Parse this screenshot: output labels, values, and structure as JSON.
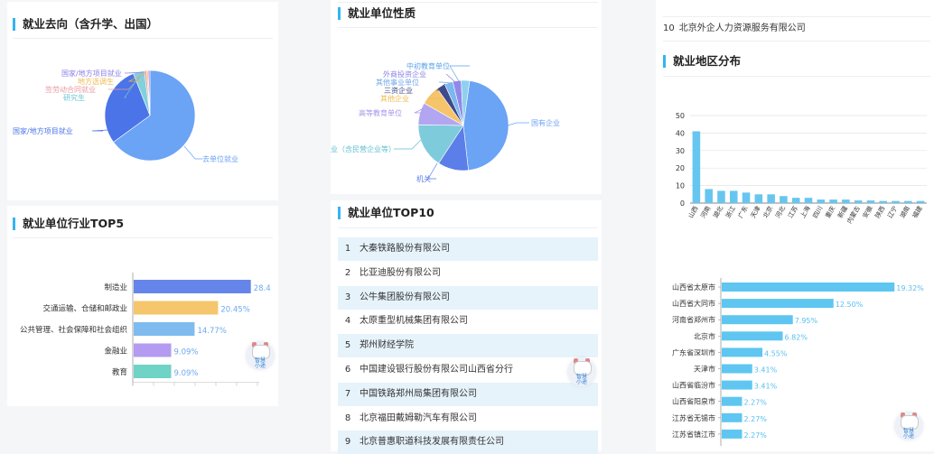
{
  "panels": {
    "destination": {
      "title": "就业去向（含升学、出国）",
      "slice_labels": [
        "国家/地方项目就业",
        "地方选调生",
        "签劳动合同就业",
        "研究生",
        "国家/地方项目就业",
        "去单位就业"
      ],
      "chart_data": {
        "type": "pie",
        "labels": [
          "去单位就业",
          "国家/地方项目就业",
          "研究生",
          "签劳动合同就业",
          "地方选调生",
          "国家/地方项目就业"
        ],
        "values": [
          65,
          29,
          4,
          0.8,
          0.6,
          0.6
        ],
        "colors": [
          "#6ba3f5",
          "#4a74e8",
          "#7fd1dd",
          "#e8a0a6",
          "#f5c66b",
          "#9a8df0"
        ]
      }
    },
    "unit_nature": {
      "title": "就业单位性质",
      "slice_labels": [
        "中初教育单位",
        "外商投资企业",
        "其他事业单位",
        "三资企业",
        "其他企业",
        "高等教育单位",
        "业（含民营企业等）",
        "机关",
        "国有企业"
      ],
      "chart_data": {
        "type": "pie",
        "labels": [
          "国有企业",
          "机关",
          "其他企业（含民营企业等）",
          "高等教育单位",
          "其他企业",
          "三资企业",
          "其他事业单位",
          "外商投资企业",
          "中初教育单位"
        ],
        "values": [
          46,
          11,
          16,
          8,
          7,
          3,
          3,
          3,
          3
        ],
        "colors": [
          "#6ba3f5",
          "#5c7ee8",
          "#7ecbdb",
          "#b2a6f0",
          "#f6c46b",
          "#3e4a8a",
          "#7bb8f0",
          "#9188e8",
          "#8fd0ef"
        ]
      }
    },
    "region": {
      "title": "就业地区分布",
      "chart_data": {
        "type": "bar",
        "categories": [
          "山西",
          "河南",
          "湖北",
          "浙江",
          "广东",
          "天津",
          "北京",
          "河北",
          "江苏",
          "上海",
          "四川",
          "重庆",
          "新疆",
          "内蒙古",
          "安徽",
          "陕西",
          "辽宁",
          "湖南",
          "福建"
        ],
        "values": [
          41,
          8,
          7,
          7,
          6,
          5,
          5,
          4,
          3,
          3,
          2,
          2,
          2,
          1.5,
          1.5,
          1.2,
          1.2,
          1.2,
          1.2
        ],
        "ylim": [
          0,
          50
        ],
        "yticks": [
          "0",
          "10",
          "20",
          "30",
          "40",
          "50"
        ],
        "color": "#66c6f0"
      }
    },
    "industry": {
      "title": "就业单位行业TOP5",
      "chart_data": {
        "type": "bar",
        "orientation": "horizontal",
        "categories": [
          "制造业",
          "交通运输、仓储和邮政业",
          "公共管理、社会保障和社会组织",
          "金融业",
          "教育"
        ],
        "values": [
          28.4,
          20.45,
          14.77,
          9.09,
          9.09
        ],
        "value_labels": [
          "28.4",
          "20.45%",
          "14.77%",
          "9.09%",
          "9.09%"
        ],
        "colors": [
          "#6685ea",
          "#f5c66b",
          "#7fbbee",
          "#b49af0",
          "#6fd3c6"
        ],
        "xlim": [
          0,
          30
        ]
      }
    },
    "top10": {
      "title": "就业单位TOP10",
      "items": [
        {
          "rank": "1",
          "name": "大秦铁路股份有限公司"
        },
        {
          "rank": "2",
          "name": "比亚迪股份有限公司"
        },
        {
          "rank": "3",
          "name": "公牛集团股份有限公司"
        },
        {
          "rank": "4",
          "name": "太原重型机械集团有限公司"
        },
        {
          "rank": "5",
          "name": "郑州财经学院"
        },
        {
          "rank": "6",
          "name": "中国建设银行股份有限公司山西省分行"
        },
        {
          "rank": "7",
          "name": "中国铁路郑州局集团有限公司"
        },
        {
          "rank": "8",
          "name": "北京福田戴姆勒汽车有限公司"
        },
        {
          "rank": "9",
          "name": "北京普惠职道科技发展有限责任公司"
        },
        {
          "rank": "10",
          "name": "北京外企人力资源服务有限公司"
        }
      ]
    },
    "city": {
      "chart_data": {
        "type": "bar",
        "orientation": "horizontal",
        "categories": [
          "山西省太原市",
          "山西省大同市",
          "河南省郑州市",
          "北京市",
          "广东省深圳市",
          "天津市",
          "山西省临汾市",
          "山西省阳泉市",
          "江苏省无锡市",
          "江苏省镇江市"
        ],
        "values": [
          19.32,
          12.5,
          7.95,
          6.82,
          4.55,
          3.41,
          3.41,
          2.27,
          2.27,
          2.27
        ],
        "value_labels": [
          "19.32%",
          "12.50%",
          "7.95%",
          "6.82%",
          "4.55%",
          "3.41%",
          "3.41%",
          "2.27%",
          "2.27%",
          "2.27%"
        ],
        "xlim": [
          0,
          20
        ],
        "color": "#5ec6f1",
        "label_color": "#59bff0"
      }
    }
  },
  "mascot": {
    "label": "智慧小途",
    "line1": "智慧",
    "line2": "小途"
  }
}
